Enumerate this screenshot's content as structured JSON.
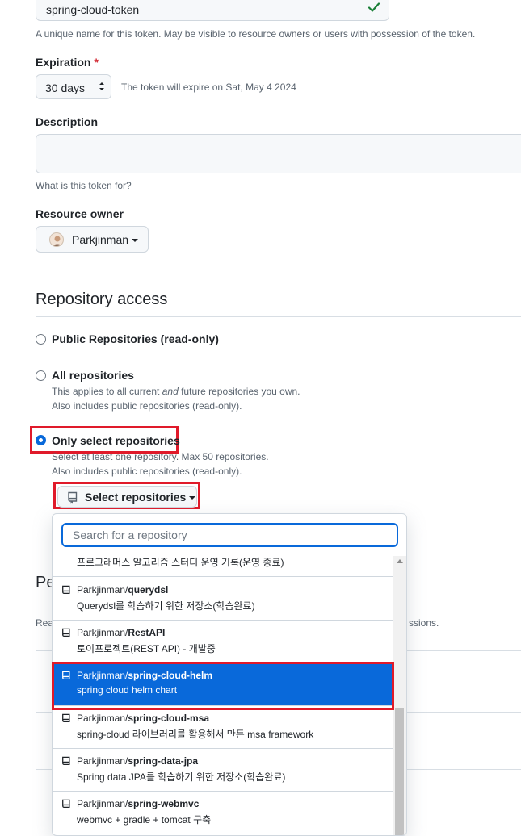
{
  "token": {
    "name_value": "spring-cloud-token",
    "name_help": "A unique name for this token. May be visible to resource owners or users with possession of the token."
  },
  "expiration": {
    "label": "Expiration",
    "required_mark": "*",
    "selected": "30 days",
    "help": "The token will expire on Sat, May 4 2024"
  },
  "description": {
    "label": "Description",
    "help": "What is this token for?"
  },
  "resource_owner": {
    "label": "Resource owner",
    "owner": "Parkjinman"
  },
  "repository_access": {
    "title": "Repository access",
    "options": [
      {
        "label": "Public Repositories (read-only)",
        "lines": []
      },
      {
        "label": "All repositories",
        "lines": [
          "This applies to all current <and> future repositories you own.",
          "Also includes public repositories (read-only)."
        ]
      },
      {
        "label": "Only select repositories",
        "lines": [
          "Select at least one repository. Max 50 repositories.",
          "Also includes public repositories (read-only)."
        ]
      }
    ],
    "all_line1_pre": "This applies to all current ",
    "all_line1_em": "and",
    "all_line1_post": " future repositories you own.",
    "all_line2": "Also includes public repositories (read-only).",
    "select_line1": "Select at least one repository. Max 50 repositories.",
    "select_line2": "Also includes public repositories (read-only).",
    "select_button": "Select repositories"
  },
  "dropdown": {
    "search_placeholder": "Search for a repository",
    "partial_item_desc": "프로그래머스 알고리즘 스터디 운영 기록(운영 종료)",
    "items": [
      {
        "owner": "Parkjinman/",
        "repo": "querydsl",
        "desc": "Querydsl를 학습하기 위한 저장소(학습완료)",
        "selected": false
      },
      {
        "owner": "Parkjinman/",
        "repo": "RestAPI",
        "desc": "토이프로젝트(REST API) - 개발중",
        "selected": false
      },
      {
        "owner": "Parkjinman/",
        "repo": "spring-cloud-helm",
        "desc": "spring cloud helm chart",
        "selected": true
      },
      {
        "owner": "Parkjinman/",
        "repo": "spring-cloud-msa",
        "desc": "spring-cloud 라이브러리를 활용해서 만든 msa framework",
        "selected": false
      },
      {
        "owner": "Parkjinman/",
        "repo": "spring-data-jpa",
        "desc": "Spring data JPA를 학습하기 위한 저장소(학습완료)",
        "selected": false
      },
      {
        "owner": "Parkjinman/",
        "repo": "spring-webmvc",
        "desc": "webmvc + gradle + tomcat 구축",
        "selected": false
      }
    ]
  },
  "behind_panel": {
    "heading_fragment": "Pe",
    "text_left": "Rea",
    "text_right": "ssions."
  },
  "colors": {
    "accent": "#0969da",
    "highlight_border": "#e01a2a",
    "check_green": "#1a7f37"
  }
}
